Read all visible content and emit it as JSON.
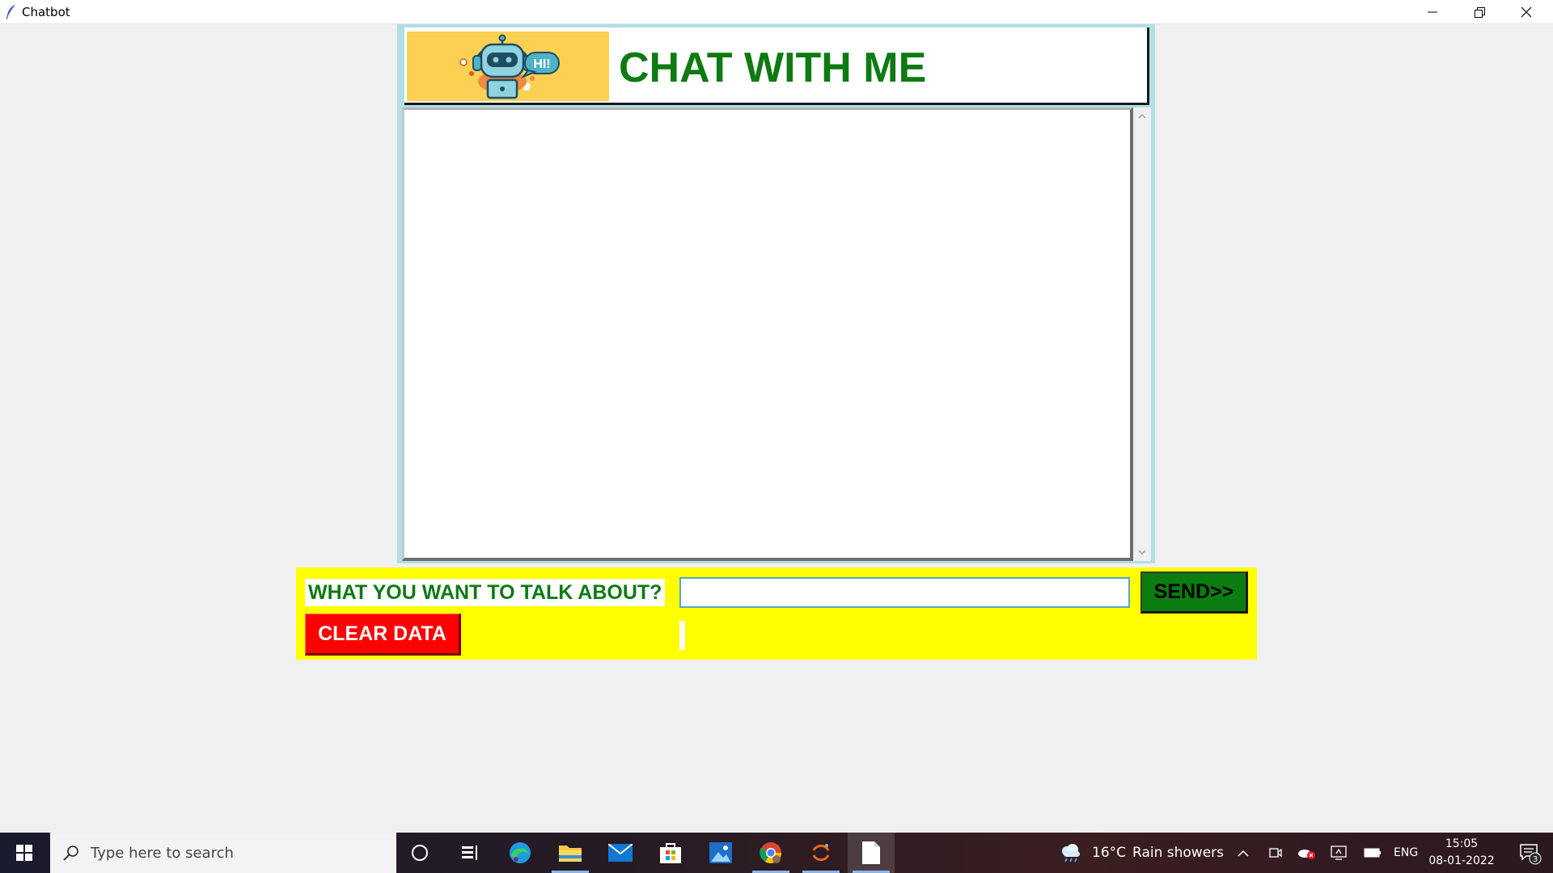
{
  "window": {
    "title": "Chatbot"
  },
  "header": {
    "logo_speech_text": "HI!",
    "title": "CHAT WITH ME",
    "title_color": "#0d7a12",
    "logo_bg_color": "#fcd052"
  },
  "chat_log": {
    "messages": []
  },
  "input_panel": {
    "prompt_label": "WHAT YOU WANT TO TALK ABOUT?",
    "message_value": "",
    "send_label": "SEND>>",
    "clear_label": "CLEAR DATA",
    "panel_color": "#ffff00",
    "send_color": "#0b7c0f",
    "clear_color": "#ff0000"
  },
  "taskbar": {
    "search_placeholder": "Type here to search",
    "pinned_icons": [
      "cortana-icon",
      "task-view-icon",
      "edge-icon",
      "file-explorer-icon",
      "mail-icon",
      "store-icon",
      "photos-icon",
      "chrome-icon",
      "python-idle-icon",
      "notepad-icon"
    ],
    "weather_temp": "16°C",
    "weather_text": "Rain showers",
    "language": "ENG",
    "time": "15:05",
    "date": "08-01-2022",
    "notification_count": "3"
  }
}
